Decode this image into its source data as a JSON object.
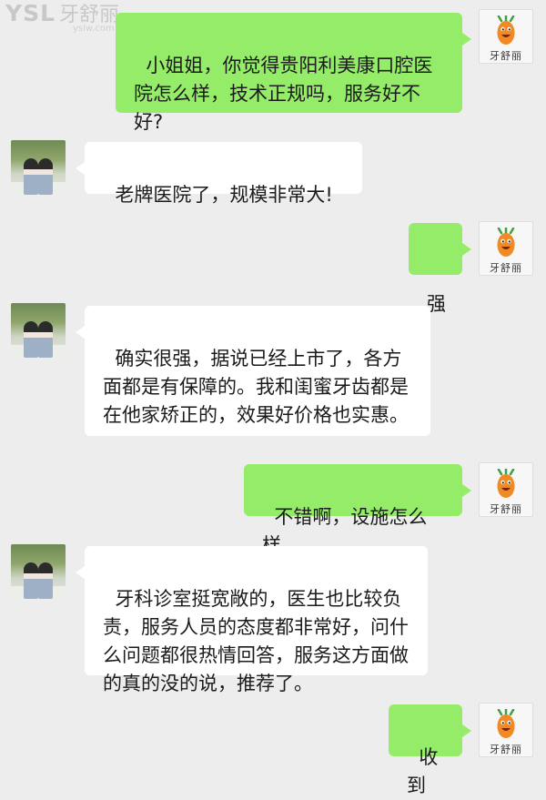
{
  "watermark": {
    "brand": "YSL",
    "brand_cn": "牙舒丽",
    "url": "yslw.com"
  },
  "avatar_label": "牙舒丽",
  "messages": [
    {
      "side": "right",
      "text": "小姐姐，你觉得贵阳利美康口腔医院怎么样，技术正规吗，服务好不好?"
    },
    {
      "side": "left",
      "text": "老牌医院了，规模非常大!"
    },
    {
      "side": "right",
      "text": "强"
    },
    {
      "side": "left",
      "text": "确实很强，据说已经上市了，各方面都是有保障的。我和闺蜜牙齿都是在他家矫正的，效果好价格也实惠。"
    },
    {
      "side": "right",
      "text": "不错啊，设施怎么样"
    },
    {
      "side": "left",
      "text": "牙科诊室挺宽敞的，医生也比较负责，服务人员的态度都非常好，问什么问题都很热情回答，服务这方面做的真的没的说，推荐了。"
    },
    {
      "side": "right",
      "text": "收到"
    }
  ],
  "colors": {
    "background": "#ededed",
    "sent_bubble": "#95ec69",
    "received_bubble": "#ffffff"
  },
  "icons": {
    "right_avatar": "carrot-mascot-icon",
    "left_avatar": "photo-avatar"
  }
}
